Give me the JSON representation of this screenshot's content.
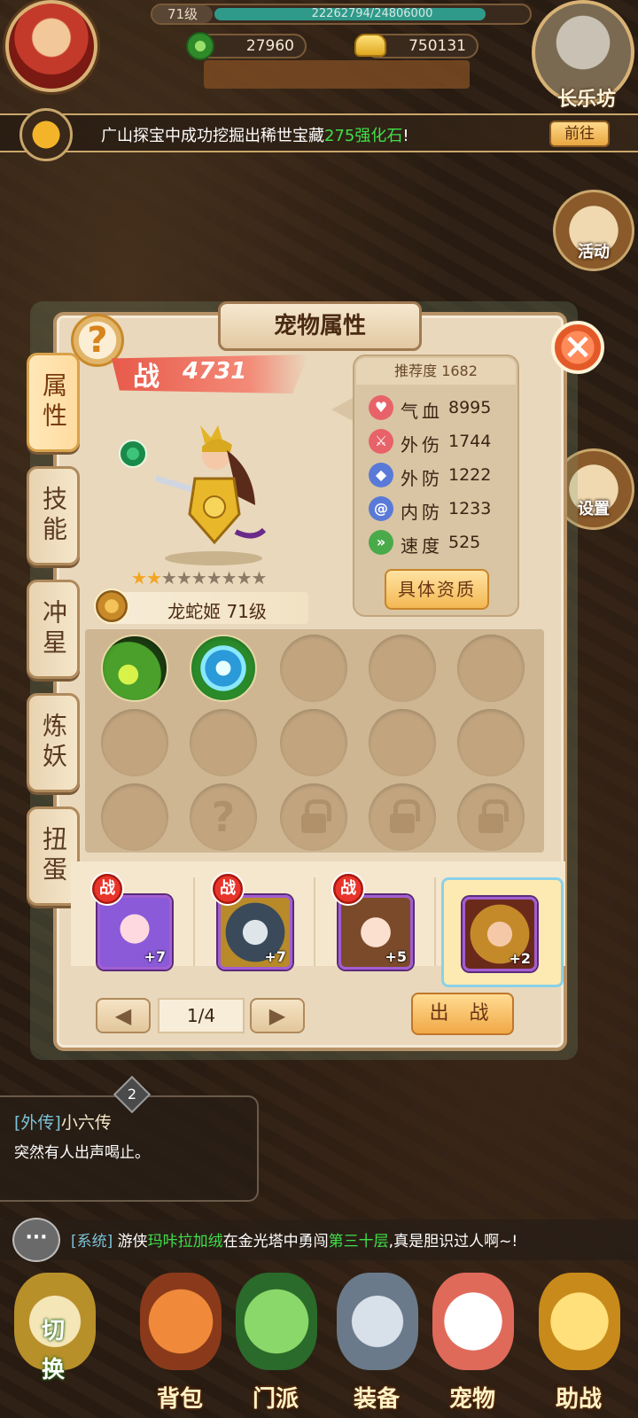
{
  "hud": {
    "level": "71级",
    "exp": "22262794/24806000",
    "exp_fraction": 0.897,
    "silver": "27960",
    "gold": "750131",
    "area": "长乐坊"
  },
  "announcement": {
    "text_before": "广山探宝中成功挖掘出稀世宝藏",
    "highlight": "275强化石",
    "text_after": "!",
    "goto_label": "前往"
  },
  "side_buttons": [
    {
      "label": "活动",
      "icon": "activity-icon"
    },
    {
      "label": "设置",
      "icon": "settings-icon"
    }
  ],
  "panel": {
    "title": "宠物属性",
    "help": "?",
    "close": "×",
    "tabs": [
      "属性",
      "技能",
      "冲星",
      "炼妖",
      "扭蛋"
    ],
    "power_icon": "战",
    "power": "4731",
    "pet_name": "龙蛇姬 71级",
    "stars_on": 2,
    "stars_total": 9,
    "recommend_label": "推荐度",
    "recommend_value": "1682",
    "stats": [
      {
        "name": "气血",
        "value": "8995",
        "icon": "heart-icon",
        "color": "#e8626a"
      },
      {
        "name": "外伤",
        "value": "1744",
        "icon": "sword-icon",
        "color": "#e8626a"
      },
      {
        "name": "外防",
        "value": "1222",
        "icon": "shield-icon",
        "color": "#5a7ad8"
      },
      {
        "name": "内防",
        "value": "1233",
        "icon": "swirl-icon",
        "color": "#5a7ad8"
      },
      {
        "name": "速度",
        "value": "525",
        "icon": "boot-icon",
        "color": "#4aaa4a"
      }
    ],
    "quality_button": "具体资质",
    "page": "1/4",
    "battle_button": "出 战",
    "fight_badge": "战",
    "pets": [
      {
        "plus": "+7",
        "in_battle": true
      },
      {
        "plus": "+7",
        "in_battle": true
      },
      {
        "plus": "+5",
        "in_battle": true
      },
      {
        "plus": "+2",
        "in_battle": false,
        "selected": true
      }
    ]
  },
  "quest": {
    "number": "2",
    "tag": "[外传]",
    "title": "小六传",
    "desc": "突然有人出声喝止。"
  },
  "chat": {
    "icon": "···",
    "sys": "[系统]",
    "t1": "游侠",
    "name": "玛咔拉加绒",
    "t2": "在金光塔中勇闯",
    "floor": "第三十层",
    "t3": ",真是胆识过人啊~!"
  },
  "nav": {
    "switch_top": "切",
    "switch_bottom": "换",
    "items": [
      "背包",
      "门派",
      "装备",
      "宠物",
      "助战"
    ]
  }
}
